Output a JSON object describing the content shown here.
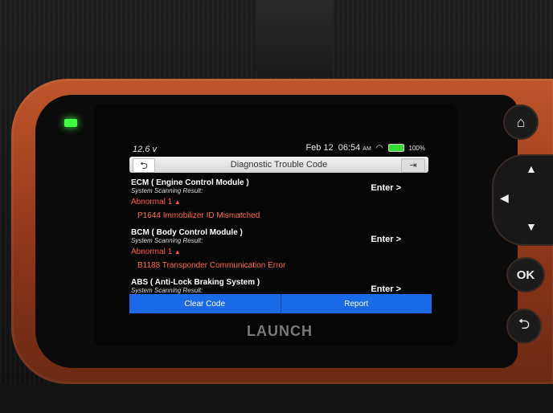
{
  "status_bar": {
    "voltage": "12.6 v",
    "date": "Feb 12",
    "time": "06:54",
    "ampm": "AM",
    "battery": "100%"
  },
  "title_bar": {
    "title": "Diagnostic Trouble Code",
    "back_icon": "back-arrow-icon",
    "exit_icon": "exit-icon"
  },
  "modules": [
    {
      "name": "ECM ( Engine Control Module )",
      "subtitle": "System Scanning Result:",
      "status": "Abnormal 1",
      "code": "P1644 Immobilizer ID Mismatched",
      "enter_label": "Enter >"
    },
    {
      "name": "BCM ( Body Control Module )",
      "subtitle": "System Scanning Result:",
      "status": "Abnormal 1",
      "code": "B1188 Transponder Communication Error",
      "enter_label": "Enter >"
    },
    {
      "name": "ABS ( Anti-Lock Braking System )",
      "subtitle": "System Scanning Result:",
      "enter_label": "Enter >"
    }
  ],
  "bottom_buttons": {
    "clear": "Clear Code",
    "report": "Report"
  },
  "brand": "LAUNCH",
  "hardware_buttons": {
    "ok": "OK"
  },
  "colors": {
    "accent_blue": "#1a6ae8",
    "error_red": "#ff5a3a",
    "device_orange": "#c0552b"
  }
}
